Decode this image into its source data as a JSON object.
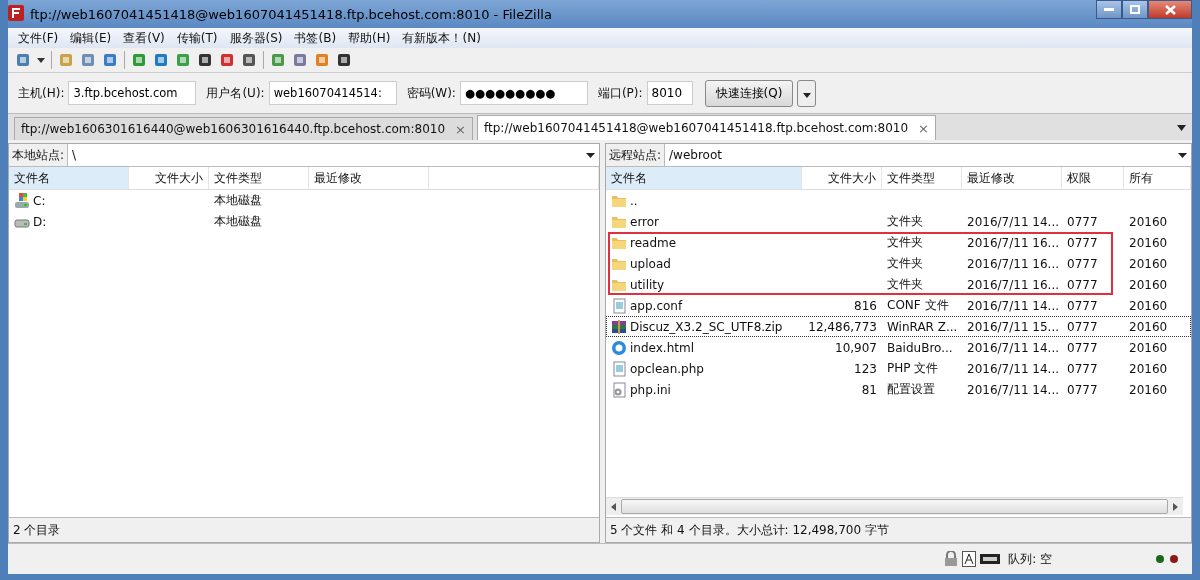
{
  "window": {
    "title": "ftp://web1607041451418@web1607041451418.ftp.bcehost.com:8010 - FileZilla"
  },
  "menu": [
    "文件(F)",
    "编辑(E)",
    "查看(V)",
    "传输(T)",
    "服务器(S)",
    "书签(B)",
    "帮助(H)",
    "有新版本！(N)"
  ],
  "quickconnect": {
    "host_label": "主机(H):",
    "host": "3.ftp.bcehost.com",
    "user_label": "用户名(U):",
    "user": "web16070414514:",
    "password_label": "密码(W):",
    "password": "●●●●●●●●●",
    "port_label": "端口(P):",
    "port": "8010",
    "button": "快速连接(Q)"
  },
  "tabs": [
    {
      "label": "ftp://web1606301616440@web1606301616440.ftp.bcehost.com:8010",
      "close": "×",
      "selected": false
    },
    {
      "label": "ftp://web1607041451418@web1607041451418.ftp.bcehost.com:8010",
      "close": "×",
      "selected": true
    }
  ],
  "local": {
    "site_label": "本地站点:",
    "path": "\\",
    "columns": [
      "文件名",
      "文件大小",
      "文件类型",
      "最近修改"
    ],
    "rows": [
      {
        "kind": "system-drive",
        "name": "C:",
        "type": "本地磁盘"
      },
      {
        "kind": "drive",
        "name": "D:",
        "type": "本地磁盘"
      }
    ],
    "status": "2 个目录"
  },
  "remote": {
    "site_label": "远程站点:",
    "path": "/webroot",
    "columns": [
      "文件名",
      "文件大小",
      "文件类型",
      "最近修改",
      "权限",
      "所有"
    ],
    "rows": [
      {
        "kind": "folder",
        "name": "..",
        "size": "",
        "type": "",
        "modified": "",
        "perm": "",
        "owner": "",
        "highlighted": false,
        "focused": false
      },
      {
        "kind": "folder",
        "name": "error",
        "size": "",
        "type": "文件夹",
        "modified": "2016/7/11 14...",
        "perm": "0777",
        "owner": "20160",
        "highlighted": false,
        "focused": false
      },
      {
        "kind": "folder",
        "name": "readme",
        "size": "",
        "type": "文件夹",
        "modified": "2016/7/11 16...",
        "perm": "0777",
        "owner": "20160",
        "highlighted": true,
        "focused": false
      },
      {
        "kind": "folder",
        "name": "upload",
        "size": "",
        "type": "文件夹",
        "modified": "2016/7/11 16...",
        "perm": "0777",
        "owner": "20160",
        "highlighted": true,
        "focused": false
      },
      {
        "kind": "folder",
        "name": "utility",
        "size": "",
        "type": "文件夹",
        "modified": "2016/7/11 16...",
        "perm": "0777",
        "owner": "20160",
        "highlighted": true,
        "focused": false
      },
      {
        "kind": "doc",
        "name": "app.conf",
        "size": "816",
        "type": "CONF 文件",
        "modified": "2016/7/11 14...",
        "perm": "0777",
        "owner": "20160",
        "highlighted": false,
        "focused": false
      },
      {
        "kind": "zip",
        "name": "Discuz_X3.2_SC_UTF8.zip",
        "size": "12,486,773",
        "type": "WinRAR Z...",
        "modified": "2016/7/11 15...",
        "perm": "0777",
        "owner": "20160",
        "highlighted": false,
        "focused": true
      },
      {
        "kind": "web",
        "name": "index.html",
        "size": "10,907",
        "type": "BaiduBro...",
        "modified": "2016/7/11 14...",
        "perm": "0777",
        "owner": "20160",
        "highlighted": false,
        "focused": false
      },
      {
        "kind": "doc",
        "name": "opclean.php",
        "size": "123",
        "type": "PHP 文件",
        "modified": "2016/7/11 14...",
        "perm": "0777",
        "owner": "20160",
        "highlighted": false,
        "focused": false
      },
      {
        "kind": "settings",
        "name": "php.ini",
        "size": "81",
        "type": "配置设置",
        "modified": "2016/7/11 14...",
        "perm": "0777",
        "owner": "20160",
        "highlighted": false,
        "focused": false
      }
    ],
    "status": "5 个文件 和 4 个目录。大小总计: 12,498,700 字节"
  },
  "queue": {
    "label": "队列: 空"
  }
}
